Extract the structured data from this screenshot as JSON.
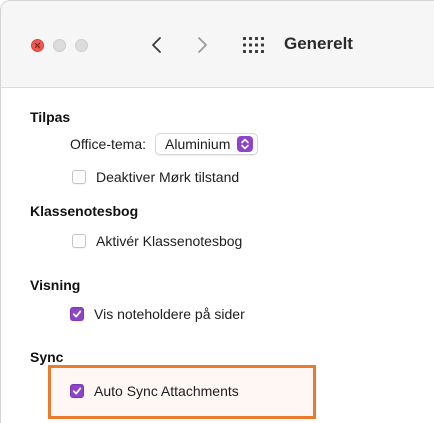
{
  "window": {
    "title": "Generelt"
  },
  "toolbar": {
    "close_icon": "close-icon",
    "back_icon": "chevron-left-icon",
    "forward_icon": "chevron-right-icon",
    "grid_icon": "grid-icon"
  },
  "sections": {
    "tilpas": {
      "title": "Tilpas",
      "office_theme_label": "Office-tema:",
      "office_theme_value": "Aluminium",
      "dark_mode_label": "Deaktiver Mørk tilstand",
      "dark_mode_checked": false
    },
    "klassenotesbog": {
      "title": "Klassenotesbog",
      "enable_label": "Aktivér Klassenotesbog",
      "enable_checked": false
    },
    "visning": {
      "title": "Visning",
      "show_containers_label": "Vis noteholdere på sider",
      "show_containers_checked": true
    },
    "sync": {
      "title": "Sync",
      "auto_sync_label": "Auto Sync Attachments",
      "auto_sync_checked": true
    }
  },
  "colors": {
    "accent": "#8e44c8",
    "highlight": "#ea7b2c"
  }
}
